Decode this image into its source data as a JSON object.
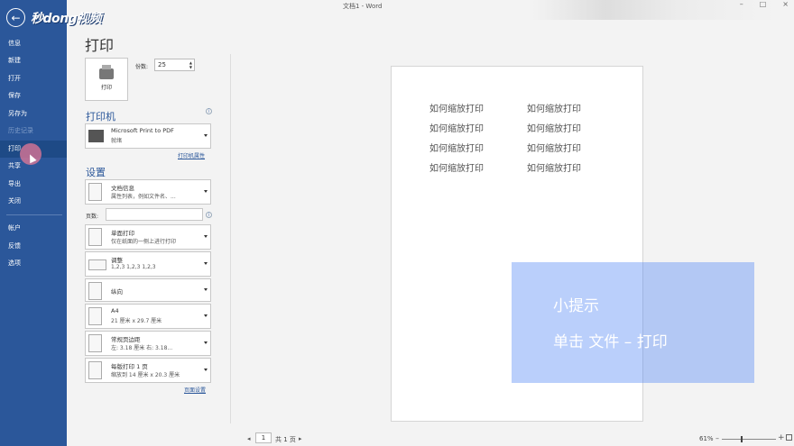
{
  "window": {
    "title": "文档1 - Word",
    "controls": [
      "–",
      "□",
      "×"
    ]
  },
  "logo": {
    "text": "秒dong视频"
  },
  "nav": {
    "back_icon": "←",
    "items": [
      {
        "label": "信息"
      },
      {
        "label": "新建"
      },
      {
        "label": "打开"
      },
      {
        "label": "保存"
      },
      {
        "label": "另存为"
      },
      {
        "label": "历史记录"
      },
      {
        "label": "打印"
      },
      {
        "label": "共享"
      },
      {
        "label": "导出"
      },
      {
        "label": "关闭"
      },
      {
        "label": "帐户"
      },
      {
        "label": "反馈"
      },
      {
        "label": "选项"
      }
    ]
  },
  "print": {
    "heading": "打印",
    "print_button_label": "打印",
    "copies_label": "份数:",
    "copies_value": "25",
    "printer_section": "打印机",
    "printer_name": "Microsoft Print to PDF",
    "printer_status": "就绪",
    "printer_properties_link": "打印机属性",
    "settings_section": "设置",
    "settings": [
      {
        "line1": "文档信息",
        "line2": "属性列表，例如文件名、..."
      },
      {
        "line1": "单面打印",
        "line2": "仅在纸面的一侧上进行打印"
      },
      {
        "line1": "调整",
        "line2": "1,2,3    1,2,3    1,2,3"
      },
      {
        "line1": "纵向",
        "line2": ""
      },
      {
        "line1": "A4",
        "line2": "21 厘米 x 29.7 厘米"
      },
      {
        "line1": "常规页边距",
        "line2": "左: 3.18 厘米    右: 3.18..."
      },
      {
        "line1": "每版打印 1 页",
        "line2": "缩放到 14 厘米 x 20.3 厘米"
      }
    ],
    "pages_label": "页数:",
    "pages_value": "",
    "page_setup_link": "页面设置"
  },
  "preview": {
    "lines": [
      "如何缩放打印",
      "如何缩放打印",
      "如何缩放打印",
      "如何缩放打印",
      "如何缩放打印",
      "如何缩放打印",
      "如何缩放打印",
      "如何缩放打印"
    ]
  },
  "tip": {
    "title": "小提示",
    "text": "单击 文件 – 打印"
  },
  "footer": {
    "prev_icon": "◂",
    "next_icon": "▸",
    "page_current": "1",
    "page_total": "共 1 页",
    "zoom": "61%"
  }
}
